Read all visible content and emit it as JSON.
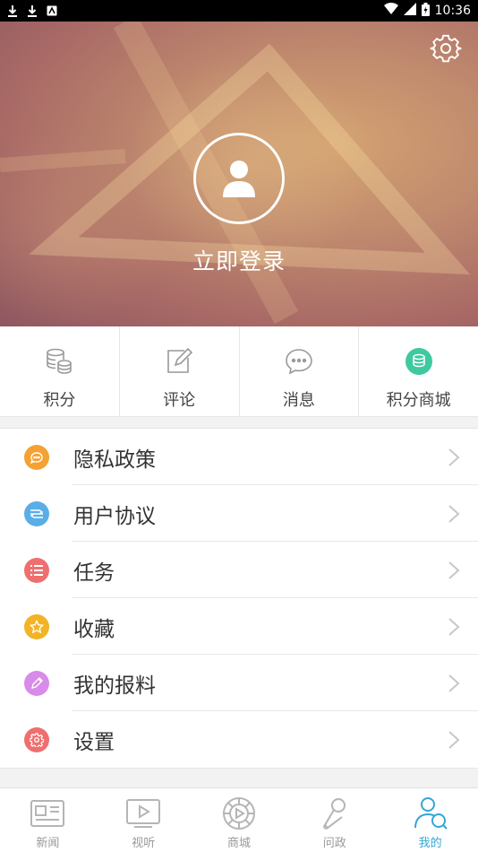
{
  "status_bar": {
    "time": "10:36"
  },
  "header": {
    "login_text": "立即登录"
  },
  "quick_tabs": [
    {
      "label": "积分",
      "icon": "coins-stack-icon"
    },
    {
      "label": "评论",
      "icon": "edit-note-icon"
    },
    {
      "label": "消息",
      "icon": "chat-bubble-icon"
    },
    {
      "label": "积分商城",
      "icon": "points-mall-icon"
    }
  ],
  "menu": [
    {
      "label": "隐私政策",
      "icon": "privacy-icon",
      "color": "#f4a234"
    },
    {
      "label": "用户协议",
      "icon": "agreement-icon",
      "color": "#5aaee8"
    },
    {
      "label": "任务",
      "icon": "task-list-icon",
      "color": "#ef6f6f"
    },
    {
      "label": "收藏",
      "icon": "star-icon",
      "color": "#f2b325"
    },
    {
      "label": "我的报料",
      "icon": "pencil-icon",
      "color": "#d88be8"
    },
    {
      "label": "设置",
      "icon": "settings-icon",
      "color": "#ef6f6f"
    }
  ],
  "bottom_nav": [
    {
      "label": "新闻",
      "icon": "newspaper-icon",
      "active": false
    },
    {
      "label": "视听",
      "icon": "video-play-icon",
      "active": false
    },
    {
      "label": "商城",
      "icon": "mall-icon",
      "active": false
    },
    {
      "label": "问政",
      "icon": "microphone-icon",
      "active": false
    },
    {
      "label": "我的",
      "icon": "user-profile-icon",
      "active": true
    }
  ],
  "colors": {
    "accent": "#33a6d8",
    "mall_green": "#3fc9a0"
  }
}
